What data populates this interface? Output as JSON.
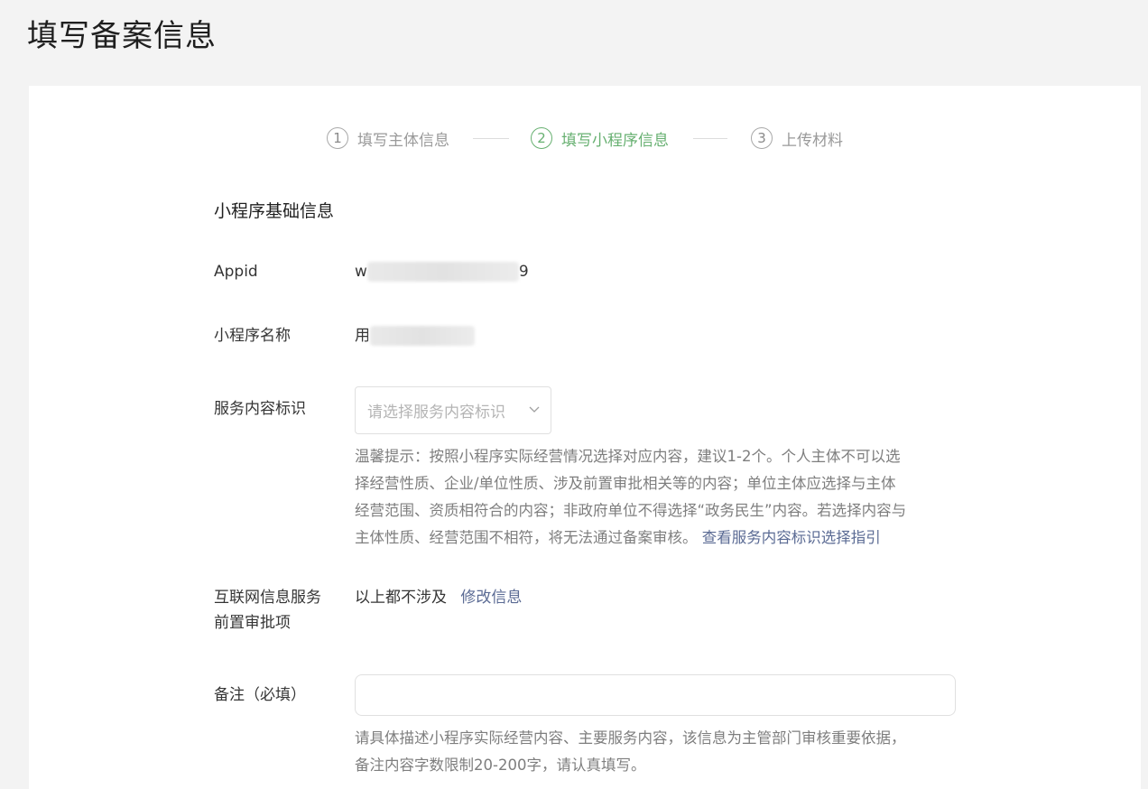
{
  "page": {
    "title": "填写备案信息"
  },
  "steps": [
    {
      "num": "1",
      "label": "填写主体信息"
    },
    {
      "num": "2",
      "label": "填写小程序信息"
    },
    {
      "num": "3",
      "label": "上传材料"
    }
  ],
  "section": {
    "title": "小程序基础信息"
  },
  "appid": {
    "label": "Appid",
    "value_start": "w",
    "value_end": "9"
  },
  "app_name": {
    "label": "小程序名称",
    "value_start": "用"
  },
  "service_tag": {
    "label": "服务内容标识",
    "placeholder": "请选择服务内容标识",
    "hint_lines": [
      "温馨提示：按照小程序实际经营情况选择对应内容，建议1-2个。个人主体不可以选",
      "择经营性质、企业/单位性质、涉及前置审批相关等的内容；单位主体应选择与主体",
      "经营范围、资质相符合的内容；非政府单位不得选择“政务民生”内容。若选择内容与",
      "主体性质、经营范围不相符，将无法通过备案审核。"
    ],
    "hint_link": "查看服务内容标识选择指引"
  },
  "pre_approval": {
    "label_line1": "互联网信息服务",
    "label_line2": "前置审批项",
    "value": "以上都不涉及",
    "edit_link": "修改信息"
  },
  "remark": {
    "label": "备注（必填）",
    "value": "",
    "hint_line1": "请具体描述小程序实际经营内容、主要服务内容，该信息为主管部门审核重要依据，",
    "hint_line2": "备注内容字数限制20-200字，请认真填写。"
  }
}
